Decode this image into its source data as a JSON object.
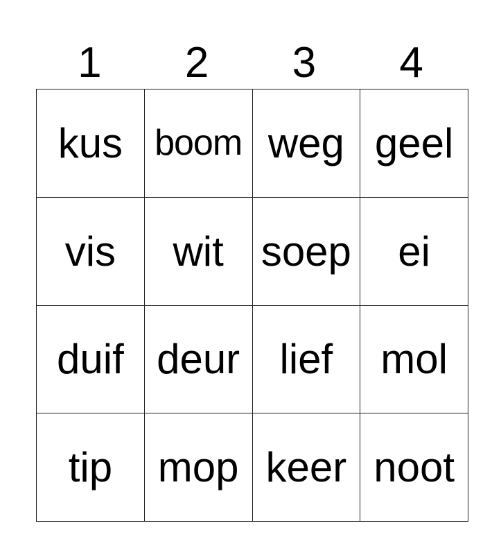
{
  "card": {
    "columns": [
      "1",
      "2",
      "3",
      "4"
    ],
    "rows": [
      [
        "kus",
        "boom",
        "weg",
        "geel"
      ],
      [
        "vis",
        "wit",
        "soep",
        "ei"
      ],
      [
        "duif",
        "deur",
        "lief",
        "mol"
      ],
      [
        "tip",
        "mop",
        "keer",
        "noot"
      ]
    ]
  }
}
